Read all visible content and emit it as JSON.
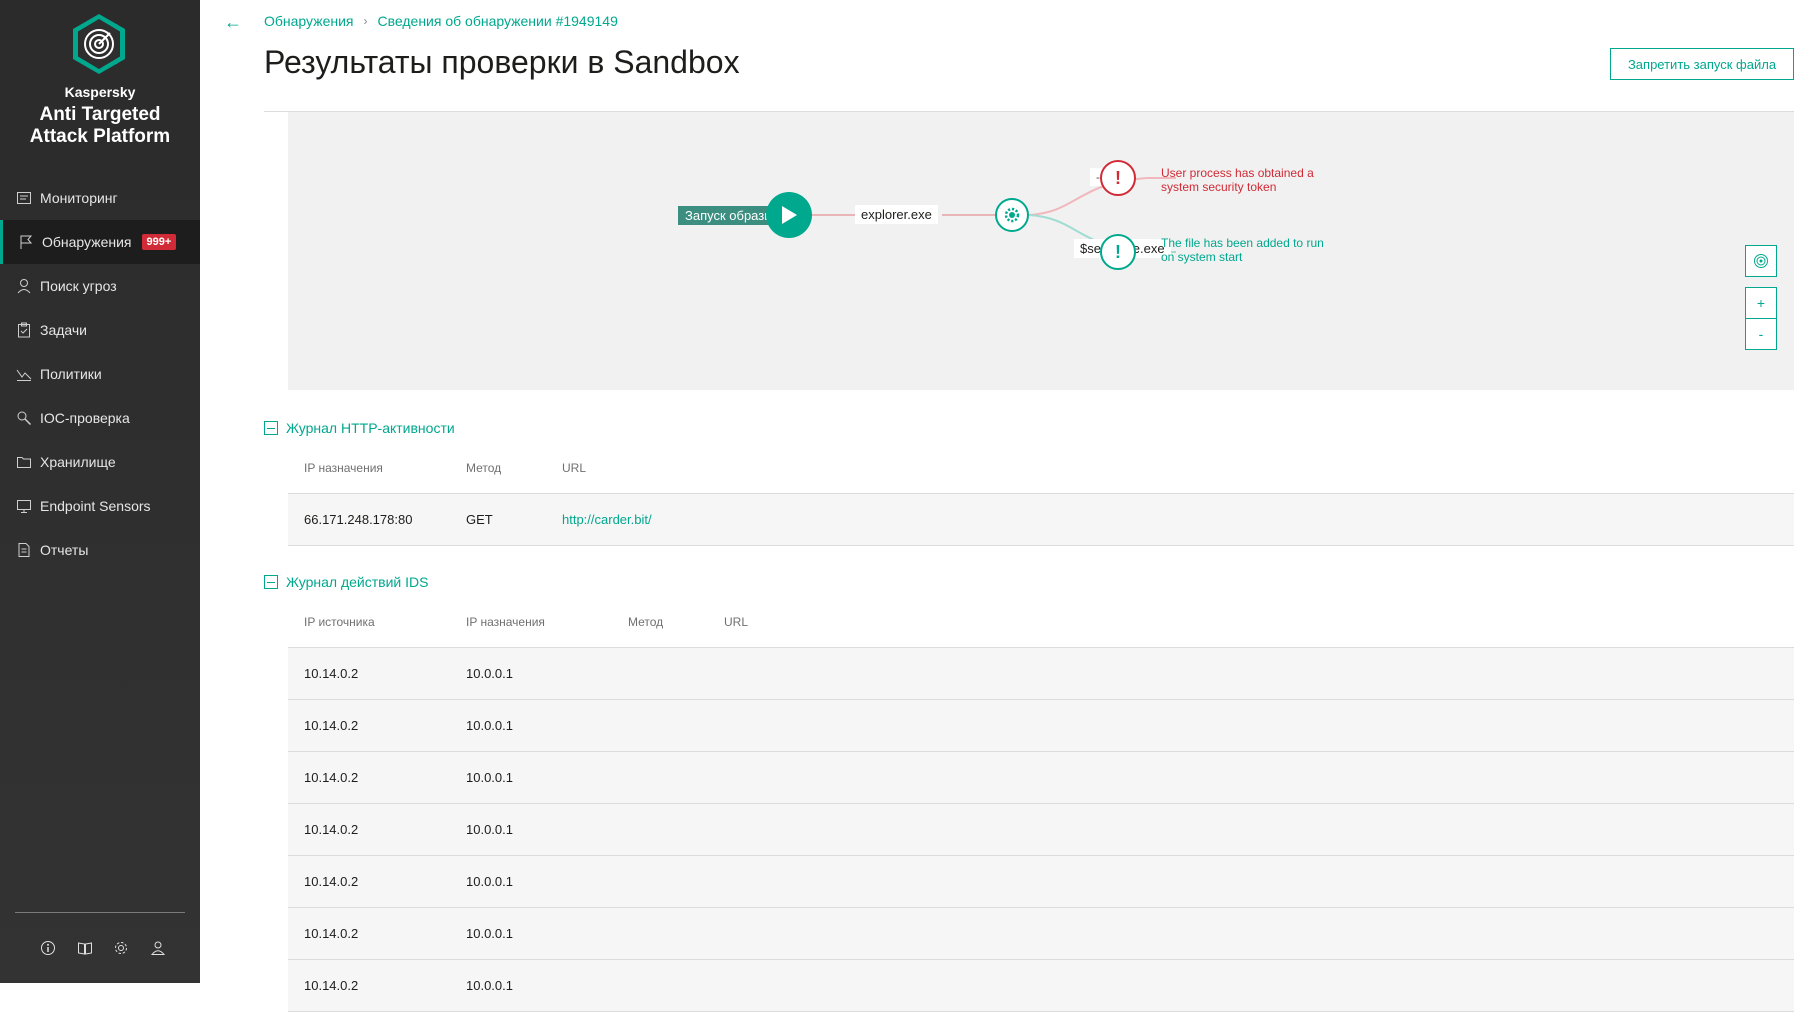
{
  "brand": {
    "company": "Kaspersky",
    "product_line1": "Anti Targeted",
    "product_line2": "Attack Platform"
  },
  "nav": [
    {
      "label": "Мониторинг",
      "icon": "monitor-icon"
    },
    {
      "label": "Обнаружения",
      "icon": "flag-icon",
      "badge": "999+",
      "active": true
    },
    {
      "label": "Поиск угроз",
      "icon": "threat-search-icon"
    },
    {
      "label": "Задачи",
      "icon": "clipboard-icon"
    },
    {
      "label": "Политики",
      "icon": "policy-icon"
    },
    {
      "label": "IOC-проверка",
      "icon": "ioc-search-icon"
    },
    {
      "label": "Хранилище",
      "icon": "folder-icon"
    },
    {
      "label": "Endpoint Sensors",
      "icon": "desktop-icon"
    },
    {
      "label": "Отчеты",
      "icon": "report-icon"
    }
  ],
  "bottom_tools": [
    "info-icon",
    "book-icon",
    "gear-icon",
    "user-icon"
  ],
  "breadcrumb": {
    "parent": "Обнаружения",
    "current": "Сведения об обнаружении #1949149"
  },
  "page_title": "Результаты проверки в Sandbox",
  "block_button": "Запретить запуск файла",
  "graph": {
    "start_label": "Запуск образца",
    "process1": "explorer.exe",
    "process2": "$selfname.exe",
    "dash": "-",
    "alert_red": "User process has obtained a system security token",
    "alert_green": "The file has been added to run on system start",
    "zoom_in": "+",
    "zoom_out": "-"
  },
  "colors": {
    "accent": "#00a88e",
    "danger": "#d02b36",
    "sidebar": "#2e2e2e"
  },
  "http_log": {
    "title": "Журнал HTTP-активности",
    "columns": [
      "IP назначения",
      "Метод",
      "URL"
    ],
    "rows": [
      {
        "ip": "66.171.248.178:80",
        "method": "GET",
        "url": "http://carder.bit/"
      }
    ]
  },
  "ids_log": {
    "title": "Журнал действий IDS",
    "columns": [
      "IP источника",
      "IP назначения",
      "Метод",
      "URL"
    ],
    "rows": [
      {
        "src": "10.14.0.2",
        "dst": "10.0.0.1"
      },
      {
        "src": "10.14.0.2",
        "dst": "10.0.0.1"
      },
      {
        "src": "10.14.0.2",
        "dst": "10.0.0.1"
      },
      {
        "src": "10.14.0.2",
        "dst": "10.0.0.1"
      },
      {
        "src": "10.14.0.2",
        "dst": "10.0.0.1"
      },
      {
        "src": "10.14.0.2",
        "dst": "10.0.0.1"
      },
      {
        "src": "10.14.0.2",
        "dst": "10.0.0.1"
      }
    ]
  }
}
